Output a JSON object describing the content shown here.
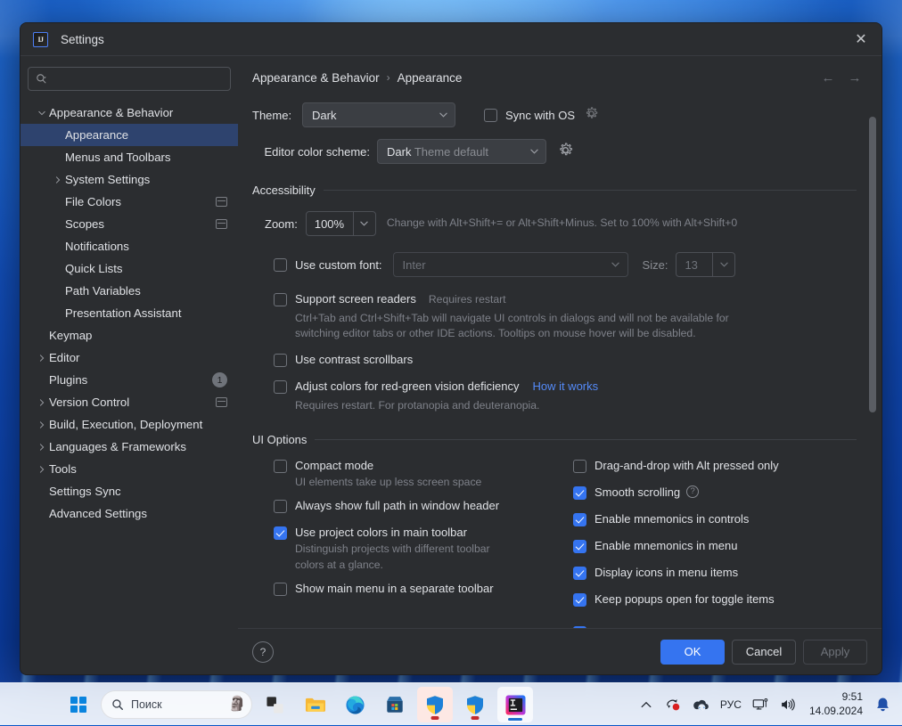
{
  "dialog": {
    "title": "Settings",
    "app_icon": "IJ",
    "close_label": "✕"
  },
  "sidebar": {
    "search_placeholder": "",
    "items": [
      {
        "label": "Appearance & Behavior",
        "indent": 0,
        "twisty": "down",
        "selected": false
      },
      {
        "label": "Appearance",
        "indent": 1,
        "twisty": "none",
        "selected": true
      },
      {
        "label": "Menus and Toolbars",
        "indent": 1,
        "twisty": "none",
        "selected": false
      },
      {
        "label": "System Settings",
        "indent": 1,
        "twisty": "right",
        "selected": false
      },
      {
        "label": "File Colors",
        "indent": 1,
        "twisty": "none",
        "selected": false,
        "trailing": "copy"
      },
      {
        "label": "Scopes",
        "indent": 1,
        "twisty": "none",
        "selected": false,
        "trailing": "copy"
      },
      {
        "label": "Notifications",
        "indent": 1,
        "twisty": "none",
        "selected": false
      },
      {
        "label": "Quick Lists",
        "indent": 1,
        "twisty": "none",
        "selected": false
      },
      {
        "label": "Path Variables",
        "indent": 1,
        "twisty": "none",
        "selected": false
      },
      {
        "label": "Presentation Assistant",
        "indent": 1,
        "twisty": "none",
        "selected": false
      },
      {
        "label": "Keymap",
        "indent": 0,
        "twisty": "none",
        "selected": false
      },
      {
        "label": "Editor",
        "indent": 0,
        "twisty": "right",
        "selected": false
      },
      {
        "label": "Plugins",
        "indent": 0,
        "twisty": "none",
        "selected": false,
        "badge": "1"
      },
      {
        "label": "Version Control",
        "indent": 0,
        "twisty": "right",
        "selected": false,
        "trailing": "copy"
      },
      {
        "label": "Build, Execution, Deployment",
        "indent": 0,
        "twisty": "right",
        "selected": false
      },
      {
        "label": "Languages & Frameworks",
        "indent": 0,
        "twisty": "right",
        "selected": false
      },
      {
        "label": "Tools",
        "indent": 0,
        "twisty": "right",
        "selected": false
      },
      {
        "label": "Settings Sync",
        "indent": 0,
        "twisty": "none",
        "selected": false
      },
      {
        "label": "Advanced Settings",
        "indent": 0,
        "twisty": "none",
        "selected": false
      }
    ]
  },
  "main": {
    "breadcrumb": {
      "root": "Appearance & Behavior",
      "separator": "›",
      "leaf": "Appearance"
    },
    "nav": {
      "back": "←",
      "forward": "→"
    },
    "theme": {
      "label": "Theme:",
      "value": "Dark",
      "sync_with_os_label": "Sync with OS",
      "sync_with_os_checked": false
    },
    "editor_scheme": {
      "label": "Editor color scheme:",
      "value_strong": "Dark",
      "value_dim": "Theme default"
    },
    "accessibility": {
      "section_title": "Accessibility",
      "zoom_label": "Zoom:",
      "zoom_value": "100%",
      "zoom_hint": "Change with Alt+Shift+= or Alt+Shift+Minus. Set to 100% with Alt+Shift+0",
      "custom_font_label": "Use custom font:",
      "custom_font_checked": false,
      "custom_font_value": "Inter",
      "size_label": "Size:",
      "size_value": "13",
      "screen_readers_label": "Support screen readers",
      "screen_readers_note": "Requires restart",
      "screen_readers_checked": false,
      "screen_readers_helper": "Ctrl+Tab and Ctrl+Shift+Tab will navigate UI controls in dialogs and will not be available for switching editor tabs or other IDE actions. Tooltips on mouse hover will be disabled.",
      "contrast_scrollbars_label": "Use contrast scrollbars",
      "contrast_scrollbars_checked": false,
      "red_green_label": "Adjust colors for red-green vision deficiency",
      "red_green_checked": false,
      "red_green_link": "How it works",
      "red_green_helper": "Requires restart. For protanopia and deuteranopia."
    },
    "ui_options": {
      "section_title": "UI Options",
      "left": [
        {
          "label": "Compact mode",
          "checked": false,
          "helper": "UI elements take up less screen space"
        },
        {
          "label": "Always show full path in window header",
          "checked": false
        },
        {
          "label": "Use project colors in main toolbar",
          "checked": true,
          "helper": "Distinguish projects with different toolbar colors at a glance."
        },
        {
          "label": "Show main menu in a separate toolbar",
          "checked": false
        }
      ],
      "right": [
        {
          "label": "Drag-and-drop with Alt pressed only",
          "checked": false
        },
        {
          "label": "Smooth scrolling",
          "checked": true,
          "help_icon": true
        },
        {
          "label": "Enable mnemonics in controls",
          "checked": true
        },
        {
          "label": "Enable mnemonics in menu",
          "checked": true
        },
        {
          "label": "Display icons in menu items",
          "checked": true
        },
        {
          "label": "Keep popups open for toggle items",
          "checked": true
        }
      ]
    }
  },
  "footer": {
    "help_label": "?",
    "ok_label": "OK",
    "cancel_label": "Cancel",
    "apply_label": "Apply"
  },
  "taskbar": {
    "search_placeholder": "Поиск",
    "apps": [
      {
        "name": "task-view",
        "glyph": ""
      },
      {
        "name": "file-explorer",
        "glyph": ""
      },
      {
        "name": "microsoft-edge",
        "glyph": ""
      },
      {
        "name": "microsoft-store",
        "glyph": ""
      },
      {
        "name": "security-app-1",
        "glyph": ""
      },
      {
        "name": "security-app-2",
        "glyph": ""
      },
      {
        "name": "intellij-idea",
        "glyph": "IJ"
      }
    ],
    "tray": {
      "chevron": "⌃",
      "language": "РУС",
      "time": "9:51",
      "date": "14.09.2024"
    }
  },
  "colors": {
    "accent_blue": "#3574F0",
    "link_blue": "#548AF7",
    "selection_blue": "#2E436E",
    "panel_bg": "#2B2D30",
    "badge_red": "#C32B2B"
  }
}
